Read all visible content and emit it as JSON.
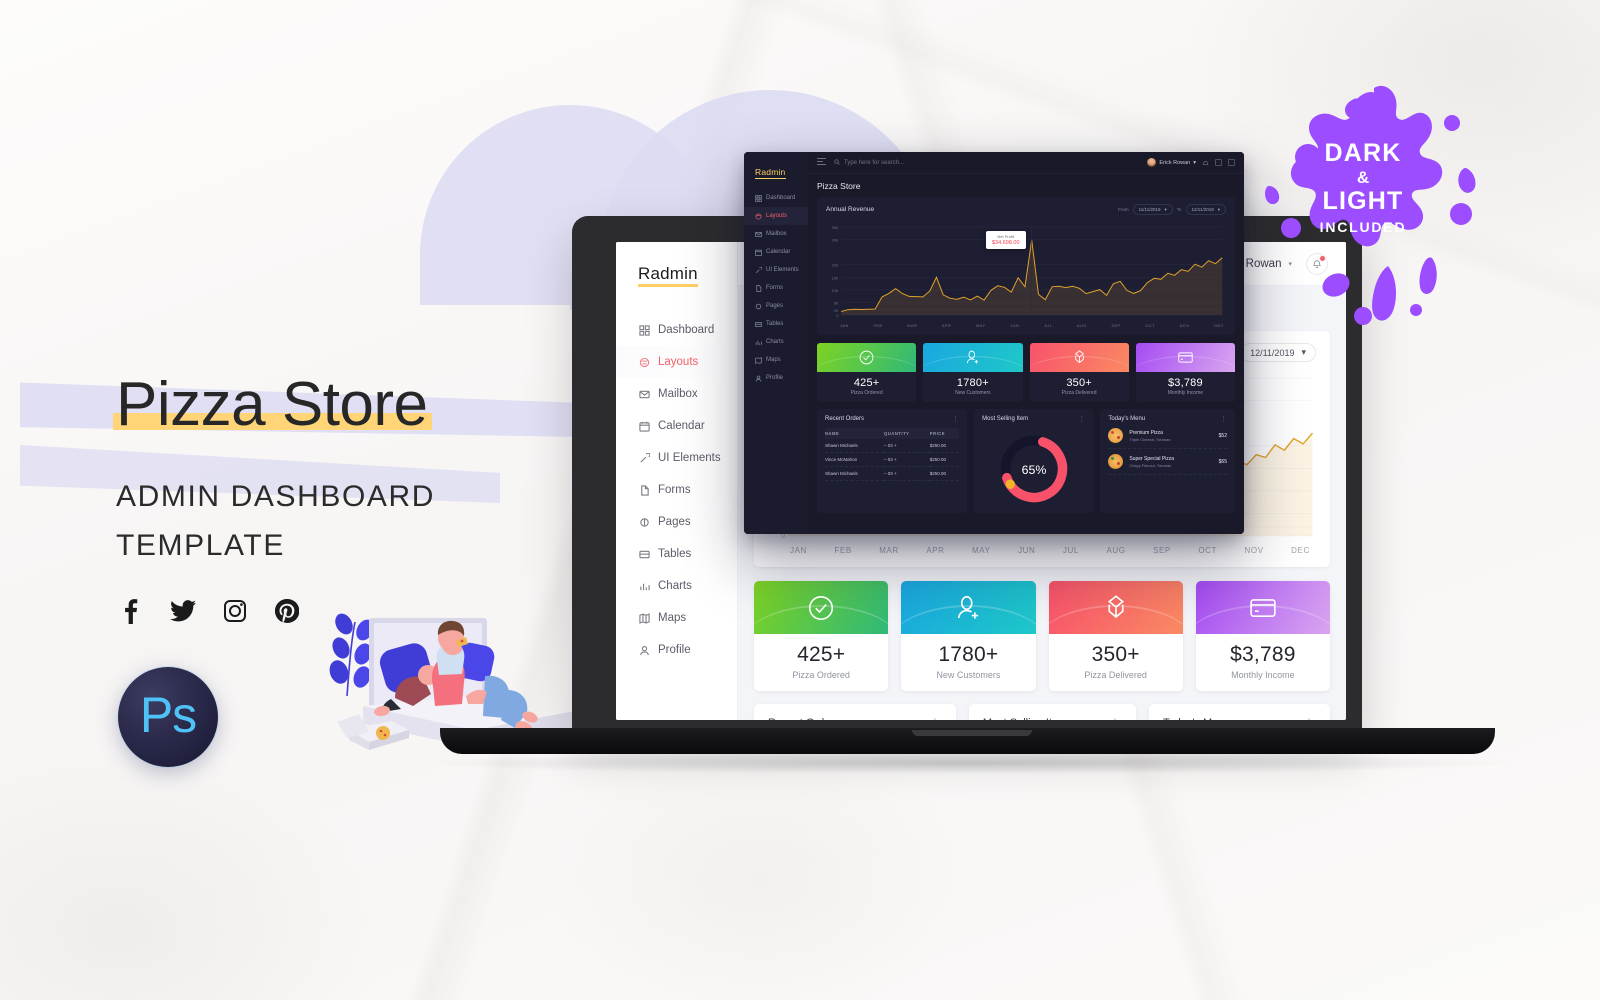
{
  "hero": {
    "title": "Pizza Store",
    "subtitle_line1": "ADMIN DASHBOARD",
    "subtitle_line2": "TEMPLATE",
    "highlight_color": "#ffd577"
  },
  "socials": [
    {
      "name": "facebook",
      "label": "Facebook"
    },
    {
      "name": "twitter",
      "label": "Twitter"
    },
    {
      "name": "instagram",
      "label": "Instagram"
    },
    {
      "name": "pinterest",
      "label": "Pinterest"
    }
  ],
  "photoshop_badge": {
    "label": "Ps",
    "accent": "#4fc3f7"
  },
  "splat": {
    "line1": "DARK",
    "line2": "&",
    "line3": "LIGHT",
    "line4": "INCLUDED",
    "color": "#9b4dff"
  },
  "dashboard": {
    "brand": "Radmin",
    "page_title": "Pizza Store",
    "search_placeholder": "Type here for search...",
    "user_name": "Erick Rowan",
    "nav": [
      {
        "label": "Dashboard",
        "icon": "grid-icon",
        "active": false
      },
      {
        "label": "Layouts",
        "icon": "layers-icon",
        "active": true
      },
      {
        "label": "Mailbox",
        "icon": "mail-icon",
        "active": false
      },
      {
        "label": "Calendar",
        "icon": "calendar-icon",
        "active": false
      },
      {
        "label": "UI Elements",
        "icon": "wand-icon",
        "active": false
      },
      {
        "label": "Forms",
        "icon": "file-icon",
        "active": false
      },
      {
        "label": "Pages",
        "icon": "pages-icon",
        "active": false
      },
      {
        "label": "Tables",
        "icon": "table-icon",
        "active": false
      },
      {
        "label": "Charts",
        "icon": "bar-chart-icon",
        "active": false
      },
      {
        "label": "Maps",
        "icon": "map-icon",
        "active": false
      },
      {
        "label": "Profile",
        "icon": "user-icon",
        "active": false
      }
    ],
    "revenue_card": {
      "title": "Annual Revenue",
      "from_label": "From",
      "from_value": "11/11/2019",
      "to_label": "To",
      "to_value": "12/11/2019",
      "tooltip_label": "Net Profit",
      "tooltip_value": "$34,698.00",
      "tooltip_color": "#f0434f"
    },
    "stats": [
      {
        "value": "425+",
        "label": "Pizza Ordered",
        "icon": "check-circle-icon",
        "color_start": "#7ed321",
        "color_end": "#2fb97a"
      },
      {
        "value": "1780+",
        "label": "New Customers",
        "icon": "user-plus-icon",
        "color_start": "#1aa7e0",
        "color_end": "#1ec8c8"
      },
      {
        "value": "350+",
        "label": "Pizza Delivered",
        "icon": "box-icon",
        "color_start": "#f8526b",
        "color_end": "#fa8a63"
      },
      {
        "value": "$3,789",
        "label": "Monthly Income",
        "icon": "credit-card-icon",
        "color_start": "#a44bf2",
        "color_end": "#d9a6f0"
      }
    ],
    "recent_orders": {
      "title": "Recent Orders",
      "columns": [
        "NAME",
        "QUANTITY",
        "PRICE"
      ],
      "rows": [
        {
          "name": "Shawn Michaels",
          "quantity": "03",
          "price": "$250.00"
        },
        {
          "name": "Vince McMahon",
          "quantity": "03",
          "price": "$250.00"
        },
        {
          "name": "Shawn Michaels",
          "quantity": "03",
          "price": "$250.00"
        }
      ]
    },
    "most_selling": {
      "title": "Most Selling Item",
      "percent": "65%",
      "percent_value": 65,
      "ring_color": "#f8526b",
      "track_color": "#16162a",
      "accent_color": "#f0b429"
    },
    "todays_menu": {
      "title": "Today's Menu",
      "items": [
        {
          "name": "Premium Pizza",
          "desc": "Triple Cheese, Sezwan",
          "price": "$52",
          "icon": "pizza-icon"
        },
        {
          "name": "Super Special Pizza",
          "desc": "Crispy Flavour, Sezwan",
          "price": "$65",
          "icon": "pizza-icon"
        }
      ]
    }
  },
  "chart_data": {
    "type": "area",
    "title": "Annual Revenue",
    "xlabel": "",
    "ylabel": "",
    "ylim": [
      0,
      35000
    ],
    "grid": true,
    "legend": false,
    "line_color": "#e0a22a",
    "fill_color": "rgba(224,162,42,0.13)",
    "categories": [
      "JAN",
      "FEB",
      "MAR",
      "APR",
      "MAY",
      "JUN",
      "JUL",
      "AUG",
      "SEP",
      "OCT",
      "NOV",
      "DEC"
    ],
    "ytick_labels": [
      "0",
      "2K",
      "5K",
      "10K",
      "15K",
      "20K",
      "30K",
      "35K"
    ],
    "ytick_values": [
      0,
      2000,
      5000,
      10000,
      15000,
      20000,
      30000,
      35000
    ],
    "series": [
      {
        "name": "Annual Revenue",
        "values": [
          1400,
          2100,
          2300,
          2200,
          2300,
          2400,
          7200,
          8600,
          10500,
          8500,
          7400,
          7300,
          7200,
          9500,
          15000,
          8000,
          6700,
          6200,
          7100,
          6000,
          7500,
          5900,
          9800,
          11600,
          11000,
          9100,
          14800,
          11200,
          29800,
          8200,
          6100,
          11200,
          11400,
          10900,
          11400,
          10600,
          8500,
          9300,
          10100,
          7800,
          12400,
          13400,
          9800,
          8600,
          9700,
          12900,
          14600,
          14200,
          16600,
          15800,
          18000,
          17400,
          20200,
          19000,
          21600,
          20400,
          22800
        ]
      }
    ]
  }
}
